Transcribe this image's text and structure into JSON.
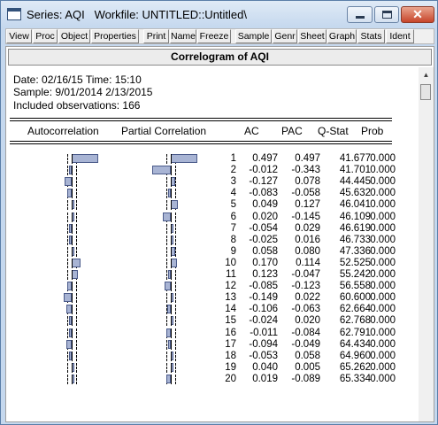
{
  "window": {
    "title": "Series: AQI   Workfile: UNTITLED::Untitled\\",
    "close_glyph": "✕"
  },
  "toolbar": {
    "buttons": [
      "View",
      "Proc",
      "Object",
      "Properties",
      "Print",
      "Name",
      "Freeze",
      "Sample",
      "Genr",
      "Sheet",
      "Graph",
      "Stats",
      "Ident"
    ]
  },
  "view": {
    "header": "Correlogram of AQI",
    "date_line": "Date: 02/16/15   Time: 15:10",
    "sample_line": "Sample: 9/01/2014 2/13/2015",
    "obs_line": "Included observations: 166",
    "col_autocorrelation": "Autocorrelation",
    "col_partial": "Partial Correlation",
    "col_ac": "AC",
    "col_pac": "PAC",
    "col_qstat": "Q-Stat",
    "col_prob": "Prob"
  },
  "correlogram": {
    "rows": [
      {
        "lag": "1",
        "ac": "0.497",
        "pac": "0.497",
        "q": "41.677",
        "prob": "0.000"
      },
      {
        "lag": "2",
        "ac": "-0.012",
        "pac": "-0.343",
        "q": "41.701",
        "prob": "0.000"
      },
      {
        "lag": "3",
        "ac": "-0.127",
        "pac": "0.078",
        "q": "44.445",
        "prob": "0.000"
      },
      {
        "lag": "4",
        "ac": "-0.083",
        "pac": "-0.058",
        "q": "45.632",
        "prob": "0.000"
      },
      {
        "lag": "5",
        "ac": "0.049",
        "pac": "0.127",
        "q": "46.041",
        "prob": "0.000"
      },
      {
        "lag": "6",
        "ac": "0.020",
        "pac": "-0.145",
        "q": "46.109",
        "prob": "0.000"
      },
      {
        "lag": "7",
        "ac": "-0.054",
        "pac": "0.029",
        "q": "46.619",
        "prob": "0.000"
      },
      {
        "lag": "8",
        "ac": "-0.025",
        "pac": "0.016",
        "q": "46.733",
        "prob": "0.000"
      },
      {
        "lag": "9",
        "ac": "0.058",
        "pac": "0.080",
        "q": "47.336",
        "prob": "0.000"
      },
      {
        "lag": "10",
        "ac": "0.170",
        "pac": "0.114",
        "q": "52.525",
        "prob": "0.000"
      },
      {
        "lag": "11",
        "ac": "0.123",
        "pac": "-0.047",
        "q": "55.242",
        "prob": "0.000"
      },
      {
        "lag": "12",
        "ac": "-0.085",
        "pac": "-0.123",
        "q": "56.558",
        "prob": "0.000"
      },
      {
        "lag": "13",
        "ac": "-0.149",
        "pac": "0.022",
        "q": "60.600",
        "prob": "0.000"
      },
      {
        "lag": "14",
        "ac": "-0.106",
        "pac": "-0.063",
        "q": "62.664",
        "prob": "0.000"
      },
      {
        "lag": "15",
        "ac": "-0.024",
        "pac": "0.020",
        "q": "62.768",
        "prob": "0.000"
      },
      {
        "lag": "16",
        "ac": "-0.011",
        "pac": "-0.084",
        "q": "62.791",
        "prob": "0.000"
      },
      {
        "lag": "17",
        "ac": "-0.094",
        "pac": "-0.049",
        "q": "64.434",
        "prob": "0.000"
      },
      {
        "lag": "18",
        "ac": "-0.053",
        "pac": "0.058",
        "q": "64.960",
        "prob": "0.000"
      },
      {
        "lag": "19",
        "ac": "0.040",
        "pac": "0.005",
        "q": "65.262",
        "prob": "0.000"
      },
      {
        "lag": "20",
        "ac": "0.019",
        "pac": "-0.089",
        "q": "65.334",
        "prob": "0.000"
      }
    ]
  },
  "colors": {
    "bar_fill": "#a8b4d4",
    "bar_border": "#4a5a8a"
  }
}
